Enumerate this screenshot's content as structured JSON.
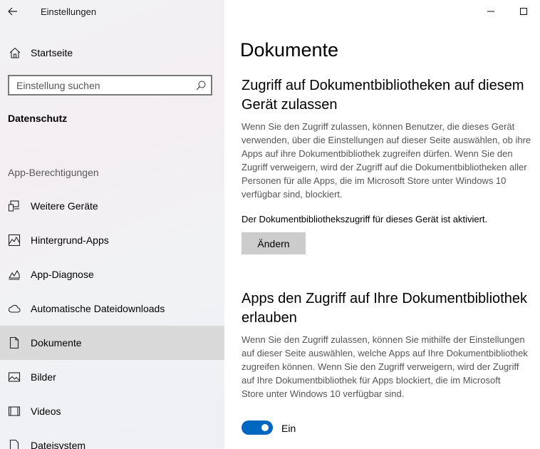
{
  "app": {
    "title": "Einstellungen"
  },
  "sidebar": {
    "home_label": "Startseite",
    "search": {
      "placeholder": "Einstellung suchen",
      "value": ""
    },
    "section_title": "Datenschutz",
    "group_title": "App-Berechtigungen",
    "items": [
      {
        "label": "Weitere Geräte",
        "icon": "devices-icon"
      },
      {
        "label": "Hintergrund-Apps",
        "icon": "background-apps-icon"
      },
      {
        "label": "App-Diagnose",
        "icon": "diagnostics-icon"
      },
      {
        "label": "Automatische Dateidownloads",
        "icon": "cloud-icon"
      },
      {
        "label": "Dokumente",
        "icon": "document-icon",
        "selected": true
      },
      {
        "label": "Bilder",
        "icon": "image-icon"
      },
      {
        "label": "Videos",
        "icon": "video-icon"
      },
      {
        "label": "Dateisystem",
        "icon": "file-system-icon"
      }
    ]
  },
  "main": {
    "page_title": "Dokumente",
    "section1": {
      "heading": [
        "Zugriff auf Dokumentbibliotheken auf diesem",
        "Gerät zulassen"
      ],
      "description": [
        "Wenn Sie den Zugriff zulassen, können Benutzer, die dieses Gerät",
        "verwenden, über die Einstellungen auf dieser Seite auswählen, ob ihre",
        "Apps auf ihre Dokumentbibliothek zugreifen dürfen. Wenn Sie den",
        "Zugriff verweigern, wird der Zugriff auf die Dokumentbibliotheken aller",
        "Personen für alle Apps, die im Microsoft Store unter Windows 10",
        "verfügbar sind, blockiert."
      ],
      "status": "Der Dokumentbibliothekszugriff für dieses Gerät ist aktiviert.",
      "button_label": "Ändern"
    },
    "section2": {
      "heading": [
        "Apps den Zugriff auf Ihre Dokumentbibliothek",
        "erlauben"
      ],
      "description": [
        "Wenn Sie den Zugriff zulassen, können Sie mithilfe der Einstellungen",
        "auf dieser Seite auswählen, welche Apps auf Ihre Dokumentbibliothek",
        "zugreifen können. Wenn Sie den Zugriff verweigern, wird der Zugriff",
        "auf Ihre Dokumentbibliothek für Apps blockiert, die im Microsoft",
        "Store unter Windows 10 verfügbar sind."
      ],
      "toggle": {
        "state": "on",
        "label": "Ein"
      }
    }
  },
  "colors": {
    "accent": "#0067c0",
    "selected_bg": "#d9d9d9",
    "button_bg": "#cccccc"
  }
}
